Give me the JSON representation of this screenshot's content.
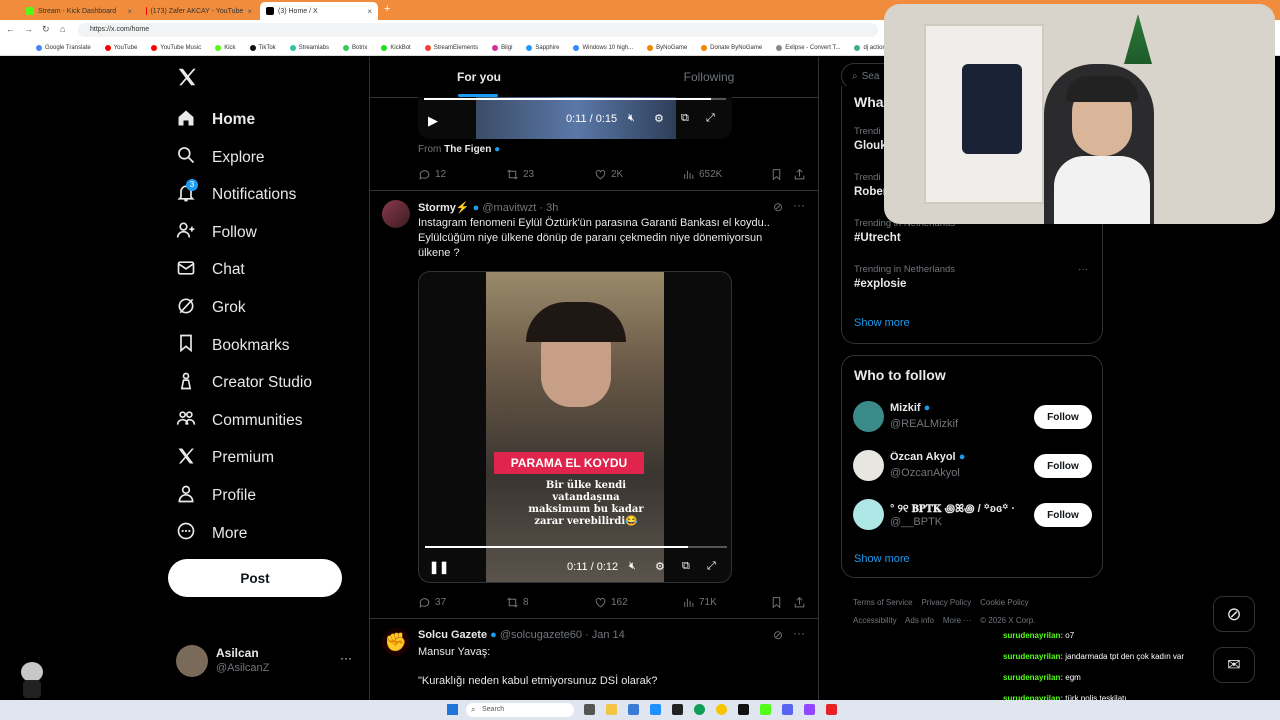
{
  "browser": {
    "tabs": [
      {
        "label": "Stream - Kick Dashboard",
        "color": "#53fc18"
      },
      {
        "label": "(173) Zafer AKCAY - YouTube",
        "color": "#ff0000"
      },
      {
        "label": "(3) Home / X",
        "color": "#000000"
      }
    ],
    "url": "https://x.com/home",
    "bookmarks": [
      "Google Translate",
      "YouTube",
      "YouTube Music",
      "Kick",
      "TikTok",
      "Streamlabs",
      "Botrix",
      "KickBot",
      "StreamElements",
      "Bilgi",
      "Sapphire",
      "Windows 10 high...",
      "ByNoGame",
      "Donate ByNoGame",
      "Exlipse - Convert T...",
      "dj action 4 -"
    ]
  },
  "nav": {
    "items": [
      {
        "label": "Home",
        "icon": "home-icon"
      },
      {
        "label": "Explore",
        "icon": "search-icon"
      },
      {
        "label": "Notifications",
        "icon": "bell-icon",
        "badge": "3"
      },
      {
        "label": "Follow",
        "icon": "person-plus-icon"
      },
      {
        "label": "Chat",
        "icon": "mail-icon"
      },
      {
        "label": "Grok",
        "icon": "grok-icon"
      },
      {
        "label": "Bookmarks",
        "icon": "bookmark-icon"
      },
      {
        "label": "Creator Studio",
        "icon": "creator-icon"
      },
      {
        "label": "Communities",
        "icon": "people-icon"
      },
      {
        "label": "Premium",
        "icon": "x-logo-icon"
      },
      {
        "label": "Profile",
        "icon": "person-icon"
      },
      {
        "label": "More",
        "icon": "more-circle-icon"
      }
    ],
    "post_label": "Post",
    "account": {
      "name": "Asilcan",
      "handle": "@AsilcanZ"
    }
  },
  "feed": {
    "tabs": [
      "For you",
      "Following"
    ],
    "prev_post": {
      "video_time": "0:11 / 0:15",
      "from_label": "From",
      "from_name": "The Figen",
      "replies": "12",
      "reposts": "23",
      "likes": "2K",
      "views": "652K"
    },
    "post": {
      "name": "Stormy⚡",
      "handle": "@mavitwzt",
      "time": "· 3h",
      "text": "Instagram fenomeni Eylül Öztürk'ün parasına Garanti Bankası el koydu.. Eylülcüğüm niye ülkene dönüp de paranı çekmedin niye dönemiyorsun ülkene ?",
      "video_banner": "PARAMA EL KOYDU",
      "video_caption": "Bir ülke kendi vatandaşına maksimum bu kadar zarar verebilirdi😂",
      "video_time": "0:11 / 0:12",
      "video_progress": 0.87,
      "replies": "37",
      "reposts": "8",
      "likes": "162",
      "views": "71K"
    },
    "post3": {
      "name": "Solcu Gazete",
      "handle": "@solcugazete60",
      "time": "· Jan 14",
      "line1": "Mansur Yavaş:",
      "line2": "\"Kuraklığı neden kabul etmiyorsunuz DSİ olarak?"
    }
  },
  "right": {
    "search_placeholder": "Sea",
    "whats_heading": "Wha",
    "trends": [
      {
        "meta": "Trendi",
        "name": "Glouk"
      },
      {
        "meta": "Trendi",
        "name": "Rober"
      },
      {
        "meta": "Trending in Netherlands",
        "name": "#Utrecht"
      },
      {
        "meta": "Trending in Netherlands",
        "name": "#explosie"
      }
    ],
    "show_more": "Show more",
    "who_to_follow": {
      "title": "Who to follow",
      "users": [
        {
          "name": "Mizkif",
          "handle": "@REALMizkif",
          "verified": true
        },
        {
          "name": "Özcan Akyol",
          "handle": "@OzcanAkyol",
          "verified": true
        },
        {
          "name": "° ୨୧ 𝐁𝐏𝐓𝐊 ꩜ꕤ꩜ / ꙳ʚ⁠ɞ꙳ ·",
          "handle": "@__BPTK",
          "verified": false
        }
      ],
      "follow_label": "Follow",
      "show_more": "Show more"
    },
    "footer": [
      "Terms of Service",
      "Privacy Policy",
      "Cookie Policy",
      "Accessibility",
      "Ads info",
      "More ···",
      "© 2026 X Corp."
    ]
  },
  "chat": [
    {
      "user": "surudenayrilan:",
      "msg": "o7"
    },
    {
      "user": "surudenayrilan:",
      "msg": "jandarmada tpt den çok kadın var"
    },
    {
      "user": "surudenayrilan:",
      "msg": "egm"
    },
    {
      "user": "surudenayrilan:",
      "msg": "türk polis teşkilatı"
    }
  ],
  "taskbar": {
    "search_placeholder": "Search"
  },
  "colors": {
    "accent": "#1d9bf0",
    "brand_orange": "#f08c3c",
    "banner_red": "#e0244b"
  }
}
